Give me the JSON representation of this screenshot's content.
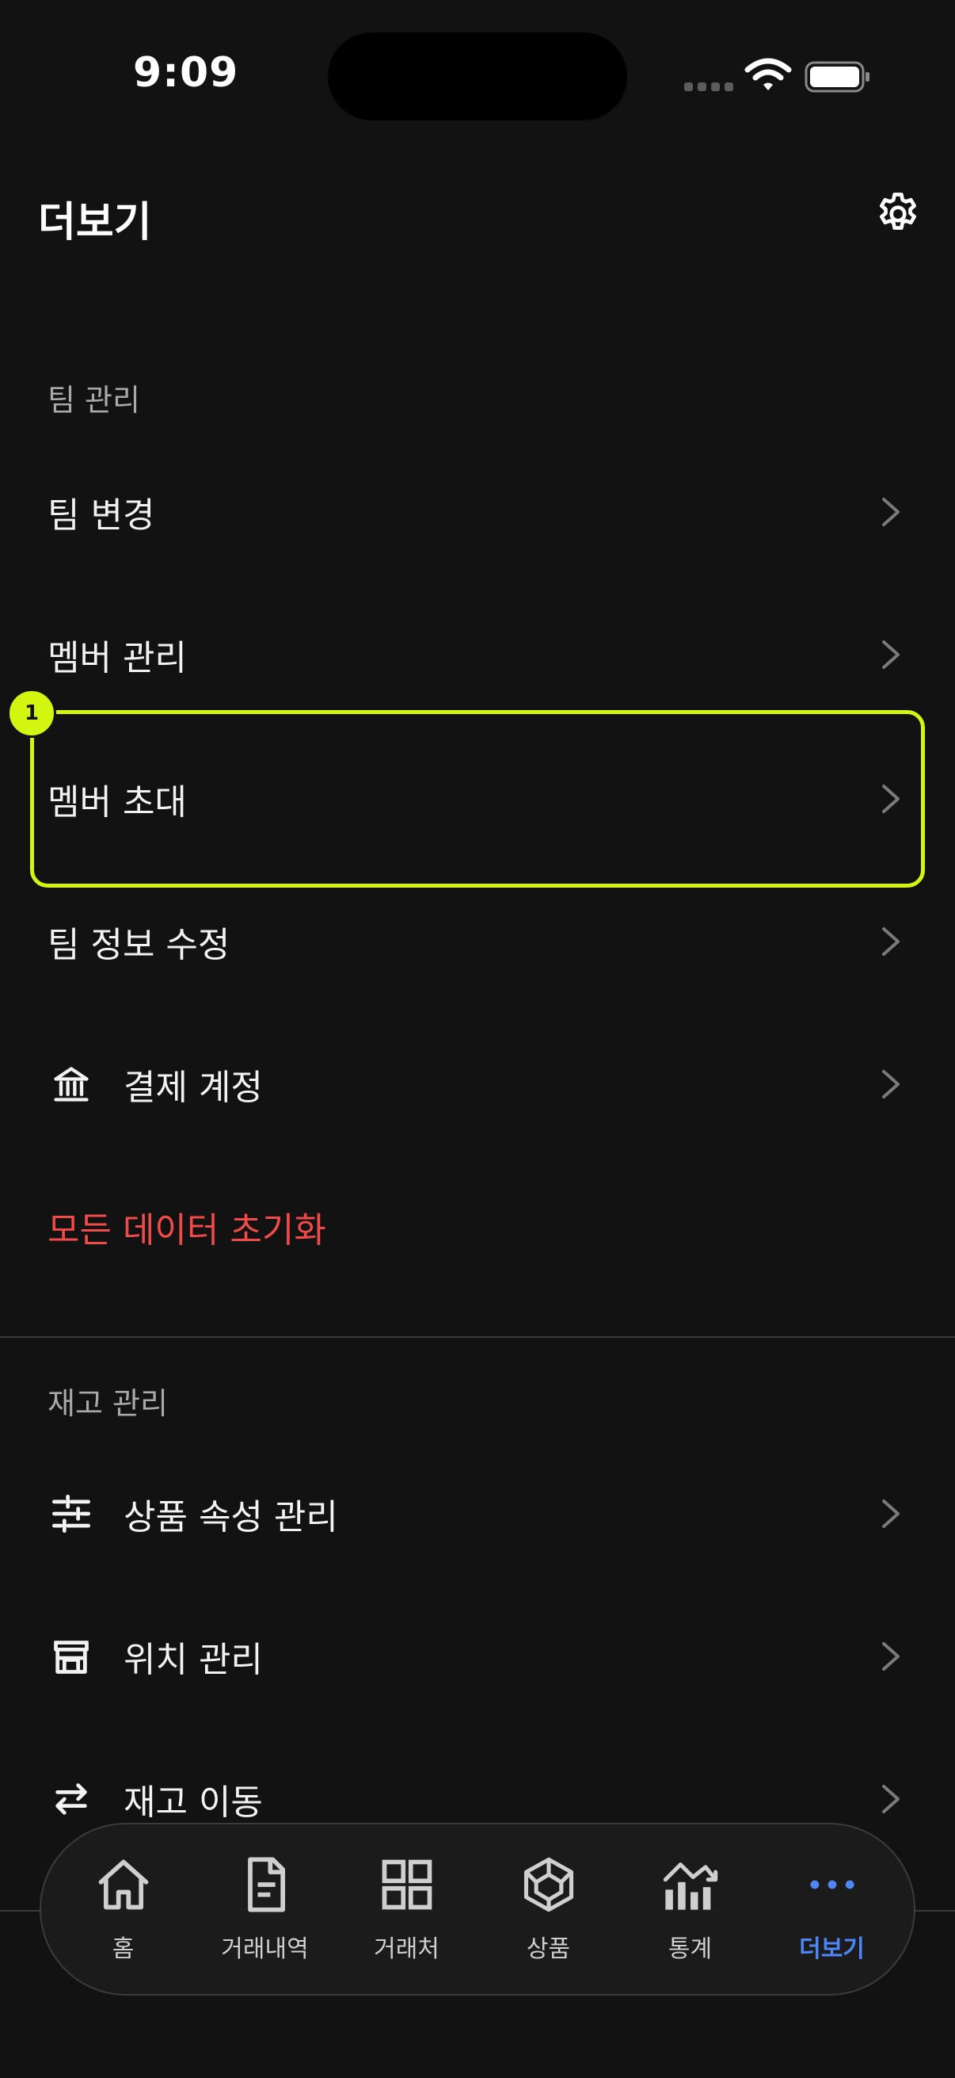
{
  "status_bar": {
    "time": "9:09"
  },
  "header": {
    "title": "더보기",
    "settings_icon": "gear-icon"
  },
  "team_section": {
    "title": "팀 관리",
    "items": [
      {
        "label": "팀 변경",
        "icon": ""
      },
      {
        "label": "멤버 관리",
        "icon": ""
      },
      {
        "label": "멤버 초대",
        "icon": ""
      },
      {
        "label": "팀 정보 수정",
        "icon": ""
      },
      {
        "label": "결제 계정",
        "icon": "bank-icon"
      }
    ],
    "reset_label": "모든 데이터 초기화"
  },
  "inventory_section": {
    "title": "재고 관리",
    "items": [
      {
        "label": "상품 속성 관리",
        "icon": "sliders-icon"
      },
      {
        "label": "위치 관리",
        "icon": "store-icon"
      },
      {
        "label": "재고 이동",
        "icon": "transfer-icon"
      }
    ]
  },
  "annotation": {
    "badge": "1"
  },
  "tabbar": {
    "tabs": [
      {
        "label": "홈",
        "icon": "home-icon"
      },
      {
        "label": "거래내역",
        "icon": "document-icon"
      },
      {
        "label": "거래처",
        "icon": "grid-icon"
      },
      {
        "label": "상품",
        "icon": "cube-icon"
      },
      {
        "label": "통계",
        "icon": "chart-icon"
      },
      {
        "label": "더보기",
        "icon": "more-icon",
        "active": true
      }
    ]
  },
  "colors": {
    "background": "#121212",
    "accent": "#4f86f7",
    "danger": "#f04a4a",
    "highlight": "#d4f50f"
  }
}
